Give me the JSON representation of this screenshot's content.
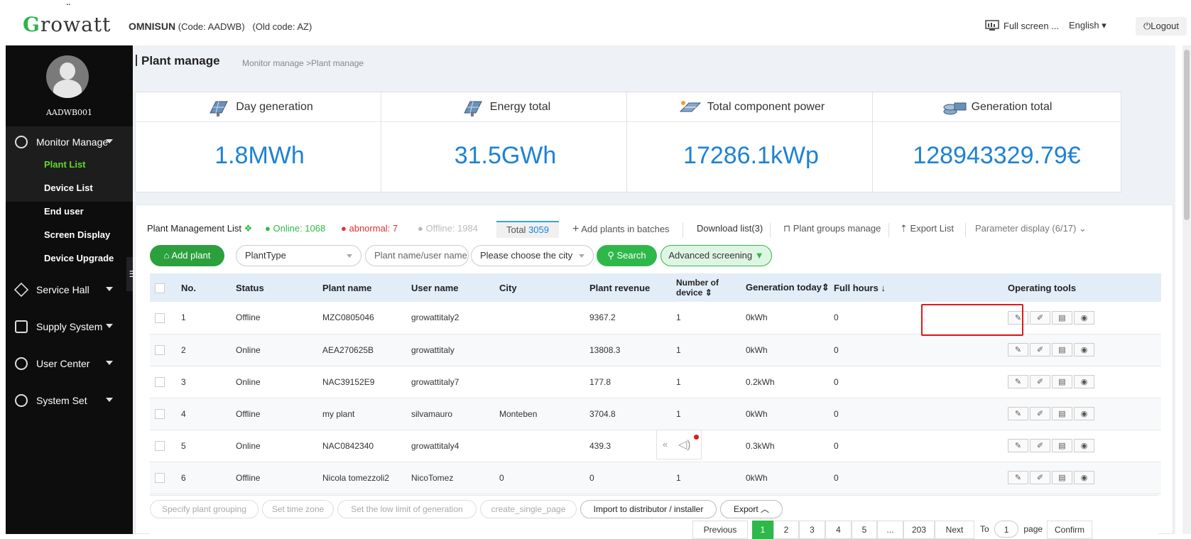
{
  "header": {
    "logo": "Growatt",
    "org_name": "OMNISUN",
    "org_code": "(Code: AADWB)",
    "org_old_code": "(Old code: AZ)",
    "fullscreen_label": "Full screen ...",
    "language": "English",
    "logout_label": "Logout"
  },
  "sidebar": {
    "username": "AADWB001",
    "monitor_manage": "Monitor Manage",
    "monitor_items": [
      "Plant List",
      "Device List",
      "End user",
      "Screen Display",
      "Device Upgrade"
    ],
    "sections": [
      "Service Hall",
      "Supply System",
      "User Center",
      "System Set"
    ]
  },
  "page": {
    "title": "Plant manage",
    "breadcrumb": "Monitor manage >Plant manage"
  },
  "stats": [
    {
      "label": "Day generation",
      "value": "1.8MWh",
      "icon": "solar-panel-icon"
    },
    {
      "label": "Energy total",
      "value": "31.5GWh",
      "icon": "solar-panel-icon"
    },
    {
      "label": "Total component power",
      "value": "17286.1kWp",
      "icon": "solar-module-icon"
    },
    {
      "label": "Generation total",
      "value": "128943329.79€",
      "icon": "money-icon"
    }
  ],
  "list_toolbar": {
    "title": "Plant Management List",
    "online": "Online: 1068",
    "abnormal": "abnormal: 7",
    "offline": "Offline: 1984",
    "total_label": "Total",
    "total_value": "3059",
    "add_batches": "Add plants in batches",
    "download_list": "Download list(3)",
    "groups_manage": "Plant groups manage",
    "export_list": "Export List",
    "parameter_display": "Parameter display",
    "parameter_count": "(6/17)"
  },
  "filters": {
    "add_plant": "Add plant",
    "plant_type": "PlantType",
    "name_placeholder": "Plant name/user name",
    "city_placeholder": "Please choose the city",
    "search": "Search",
    "advanced": "Advanced screening"
  },
  "table": {
    "columns": [
      "No.",
      "Status",
      "Plant name",
      "User name",
      "City",
      "Plant revenue",
      "Number of device",
      "Generation today",
      "Full hours",
      "Operating tools"
    ],
    "rows": [
      {
        "no": "1",
        "status": "Offline",
        "plant": "MZC0805046",
        "user": "growattitaly2",
        "city": "",
        "revenue": "9367.2",
        "devices": "1",
        "gen": "0kWh",
        "hours": "0"
      },
      {
        "no": "2",
        "status": "Online",
        "plant": "AEA270625B",
        "user": "growattitaly",
        "city": "",
        "revenue": "13808.3",
        "devices": "1",
        "gen": "0kWh",
        "hours": "0"
      },
      {
        "no": "3",
        "status": "Online",
        "plant": "NAC39152E9",
        "user": "growattitaly7",
        "city": "",
        "revenue": "177.8",
        "devices": "1",
        "gen": "0.2kWh",
        "hours": "0"
      },
      {
        "no": "4",
        "status": "Offline",
        "plant": "my plant",
        "user": "silvamauro",
        "city": "Monteben",
        "revenue": "3704.8",
        "devices": "1",
        "gen": "0kWh",
        "hours": "0"
      },
      {
        "no": "5",
        "status": "Online",
        "plant": "NAC0842340",
        "user": "growattitaly4",
        "city": "",
        "revenue": "439.3",
        "devices": "1",
        "gen": "0.3kWh",
        "hours": "0"
      },
      {
        "no": "6",
        "status": "Offline",
        "plant": "Nicola tomezzoli2",
        "user": "NicoTomez",
        "city": "0",
        "revenue": "0",
        "devices": "1",
        "gen": "0kWh",
        "hours": "0"
      }
    ]
  },
  "bottom_actions": {
    "specify_group": "Specify plant grouping",
    "time_zone": "Set time zone",
    "low_limit": "Set the low limit of generation",
    "single_page": "create_single_page",
    "import_distributor": "Import to distributor / installer",
    "export": "Export"
  },
  "pagination": {
    "previous": "Previous",
    "pages": [
      "1",
      "2",
      "3",
      "4",
      "5",
      "...",
      "203"
    ],
    "next": "Next",
    "to": "To",
    "page_input": "1",
    "page_label": "page",
    "confirm": "Confirm"
  },
  "colors": {
    "accent_green": "#2eb84a",
    "value_blue": "#1e82d4",
    "highlight_red": "#e0191a"
  }
}
